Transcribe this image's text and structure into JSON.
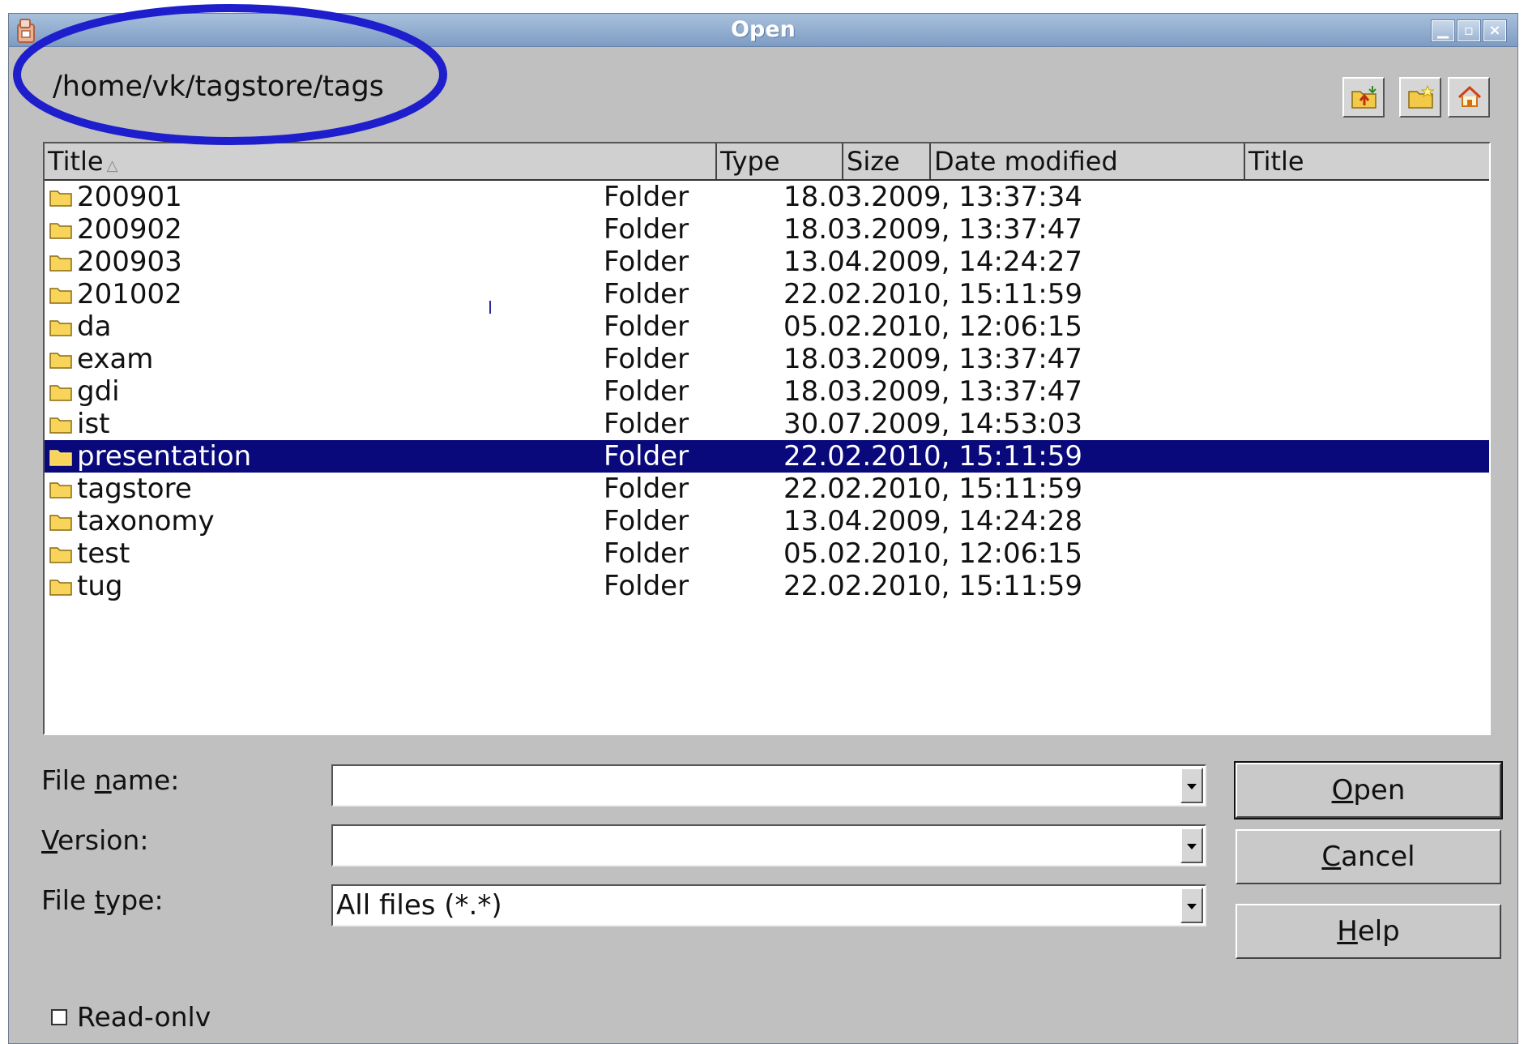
{
  "window": {
    "title": "Open"
  },
  "path": "/home/vk/tagstore/tags",
  "toolbar": {
    "up_icon": "folder-up-icon",
    "new_folder_icon": "new-folder-icon",
    "home_icon": "home-icon"
  },
  "columns": [
    "Title",
    "Type",
    "Size",
    "Date modified",
    "Title"
  ],
  "rows": [
    {
      "name": "200901",
      "type": "Folder",
      "date": "18.03.2009, 13:37:34"
    },
    {
      "name": "200902",
      "type": "Folder",
      "date": "18.03.2009, 13:37:47"
    },
    {
      "name": "200903",
      "type": "Folder",
      "date": "13.04.2009, 14:24:27"
    },
    {
      "name": "201002",
      "type": "Folder",
      "date": "22.02.2010, 15:11:59"
    },
    {
      "name": "da",
      "type": "Folder",
      "date": "05.02.2010, 12:06:15"
    },
    {
      "name": "exam",
      "type": "Folder",
      "date": "18.03.2009, 13:37:47"
    },
    {
      "name": "gdi",
      "type": "Folder",
      "date": "18.03.2009, 13:37:47"
    },
    {
      "name": "ist",
      "type": "Folder",
      "date": "30.07.2009, 14:53:03"
    },
    {
      "name": "presentation",
      "type": "Folder",
      "date": "22.02.2010, 15:11:59",
      "selected": true
    },
    {
      "name": "tagstore",
      "type": "Folder",
      "date": "22.02.2010, 15:11:59"
    },
    {
      "name": "taxonomy",
      "type": "Folder",
      "date": "13.04.2009, 14:24:28"
    },
    {
      "name": "test",
      "type": "Folder",
      "date": "05.02.2010, 12:06:15"
    },
    {
      "name": "tug",
      "type": "Folder",
      "date": "22.02.2010, 15:11:59"
    }
  ],
  "form": {
    "file_name": {
      "pre": "File ",
      "accel": "n",
      "post": "ame:",
      "value": ""
    },
    "version": {
      "pre": "",
      "accel": "V",
      "post": "ersion:",
      "value": ""
    },
    "file_type": {
      "pre": "File ",
      "accel": "t",
      "post": "ype:",
      "value": "All files (*.*)"
    }
  },
  "buttons": {
    "open": {
      "accel": "O",
      "rest": "pen"
    },
    "cancel": {
      "accel": "C",
      "rest": "ancel"
    },
    "help": {
      "accel": "H",
      "rest": "elp"
    }
  },
  "readonly_label": "Read-onlv",
  "colors": {
    "selection": "#09097c",
    "annotation_ellipse": "#1e1ecc",
    "dialog_background": "#c0c0c0"
  }
}
